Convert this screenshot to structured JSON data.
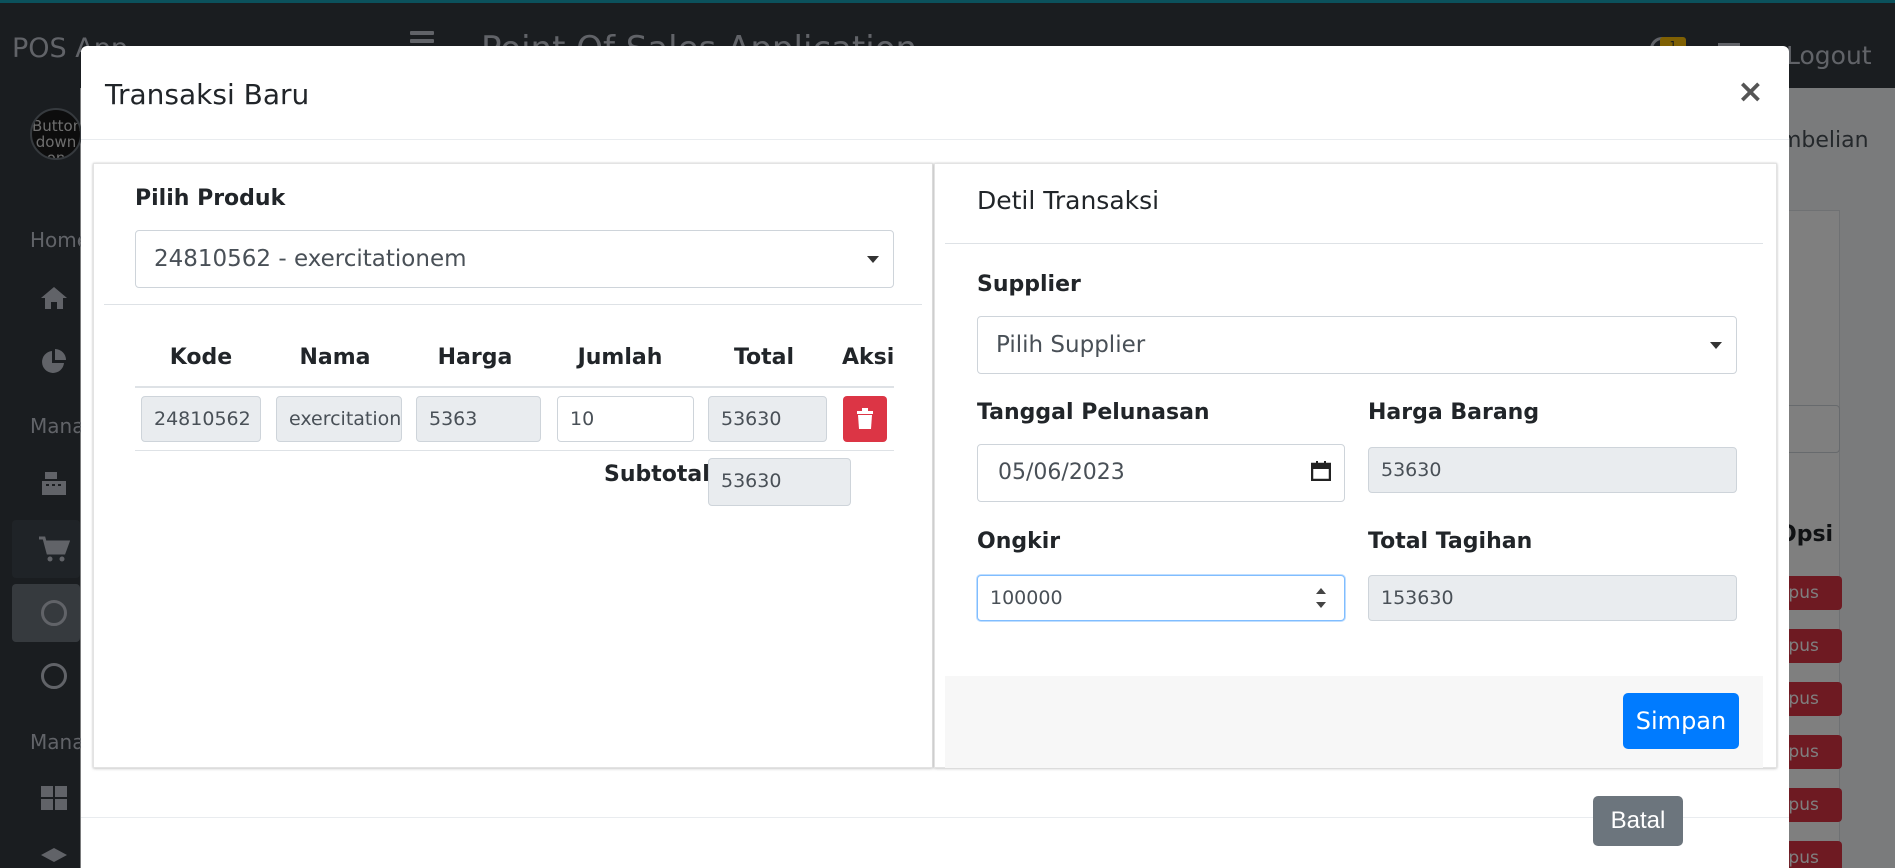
{
  "app": {
    "brand": "POS App",
    "title": "Point Of Sales Application",
    "notification_count": "1",
    "logout_label": "Logout"
  },
  "sidebar": {
    "avatar_text": "Button down on",
    "header_home": "Home",
    "header_manage_1": "Mana",
    "header_manage_2": "Mana"
  },
  "background": {
    "breadcrumb": "mbelian",
    "opsi_header": "Opsi",
    "delete_label": "apus"
  },
  "modal": {
    "title": "Transaksi Baru",
    "close_symbol": "×",
    "cancel_label": "Batal"
  },
  "product_panel": {
    "select_label": "Pilih Produk",
    "selected_product": "24810562 - exercitationem",
    "columns": [
      "Kode",
      "Nama",
      "Harga",
      "Jumlah",
      "Total",
      "Aksi"
    ],
    "rows": [
      {
        "kode": "24810562",
        "nama": "exercitationem",
        "harga": "5363",
        "jumlah": "10",
        "total": "53630"
      }
    ],
    "subtotal_label": "Subtotal",
    "subtotal_value": "53630"
  },
  "detail_panel": {
    "title": "Detil Transaksi",
    "supplier_label": "Supplier",
    "supplier_value": "Pilih Supplier",
    "tanggal_label": "Tanggal Pelunasan",
    "tanggal_value": "05/06/2023",
    "harga_barang_label": "Harga Barang",
    "harga_barang_value": "53630",
    "ongkir_label": "Ongkir",
    "ongkir_value": "100000",
    "total_tagihan_label": "Total Tagihan",
    "total_tagihan_value": "153630",
    "save_label": "Simpan"
  },
  "colors": {
    "primary": "#007bff",
    "danger": "#dc3545",
    "secondary": "#6c757d",
    "dark": "#343a40",
    "accent_top": "#17a2b8"
  }
}
